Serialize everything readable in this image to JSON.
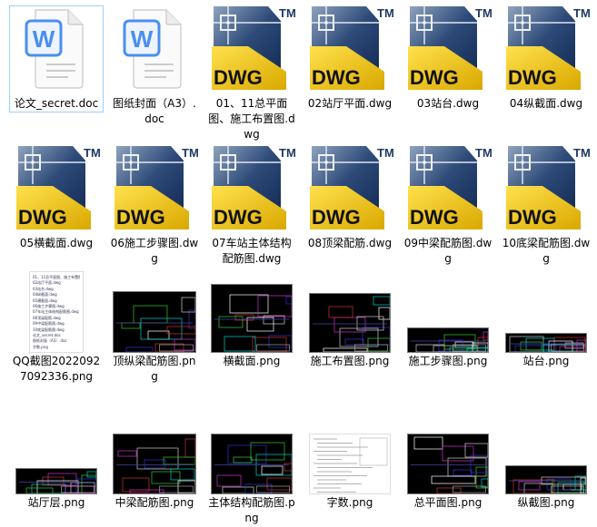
{
  "files": [
    {
      "name": "论文_secret.doc",
      "type": "doc",
      "selected": true
    },
    {
      "name": "图纸封面（A3）.doc",
      "type": "doc"
    },
    {
      "name": "01、11总平面图、施工布置图.dwg",
      "type": "dwg"
    },
    {
      "name": "02站厅平面.dwg",
      "type": "dwg"
    },
    {
      "name": "03站台.dwg",
      "type": "dwg"
    },
    {
      "name": "04纵截面.dwg",
      "type": "dwg"
    },
    {
      "name": "05横截面.dwg",
      "type": "dwg"
    },
    {
      "name": "06施工步骤图.dwg",
      "type": "dwg"
    },
    {
      "name": "07车站主体结构配筋图.dwg",
      "type": "dwg"
    },
    {
      "name": "08顶梁配筋.dwg",
      "type": "dwg"
    },
    {
      "name": "09中梁配筋图.dwg",
      "type": "dwg"
    },
    {
      "name": "10底梁配筋图.dwg",
      "type": "dwg"
    },
    {
      "name": "QQ截图20220927092336.png",
      "type": "png-light-list"
    },
    {
      "name": "顶纵梁配筋图.png",
      "type": "png-dark"
    },
    {
      "name": "横截面.png",
      "type": "png-dark"
    },
    {
      "name": "施工布置图.png",
      "type": "png-dark"
    },
    {
      "name": "施工步骤图.png",
      "type": "png-dark"
    },
    {
      "name": "站台.png",
      "type": "png-dark"
    },
    {
      "name": "站厅层.png",
      "type": "png-dark"
    },
    {
      "name": "中梁配筋图.png",
      "type": "png-dark"
    },
    {
      "name": "主体结构配筋图.png",
      "type": "png-dark"
    },
    {
      "name": "字数.png",
      "type": "png-light"
    },
    {
      "name": "总平面图.png",
      "type": "png-dark"
    },
    {
      "name": "纵截图.png",
      "type": "png-dark"
    }
  ],
  "qq_list": [
    "01、11总平面图、施工布置图.dwg",
    "02站厅平面.dwg",
    "03站台.dwg",
    "04纵截面.dwg",
    "05横截面.dwg",
    "06施工步骤图.dwg",
    "07车站主体结构配筋图.dwg",
    "08顶梁配筋.dwg",
    "09中梁配筋图.dwg",
    "10底梁配筋图.dwg",
    "论文_secret.doc",
    "图纸封面（A3）.doc",
    "字数.png"
  ],
  "icon_text": {
    "dwg": "DWG",
    "tm": "TM",
    "word": "W"
  },
  "colors": {
    "word_blue": "#4a8ef0",
    "dwg_yellow": "#f2c300",
    "dwg_navy": "#1f3a66",
    "select_border": "#99d1ff"
  }
}
